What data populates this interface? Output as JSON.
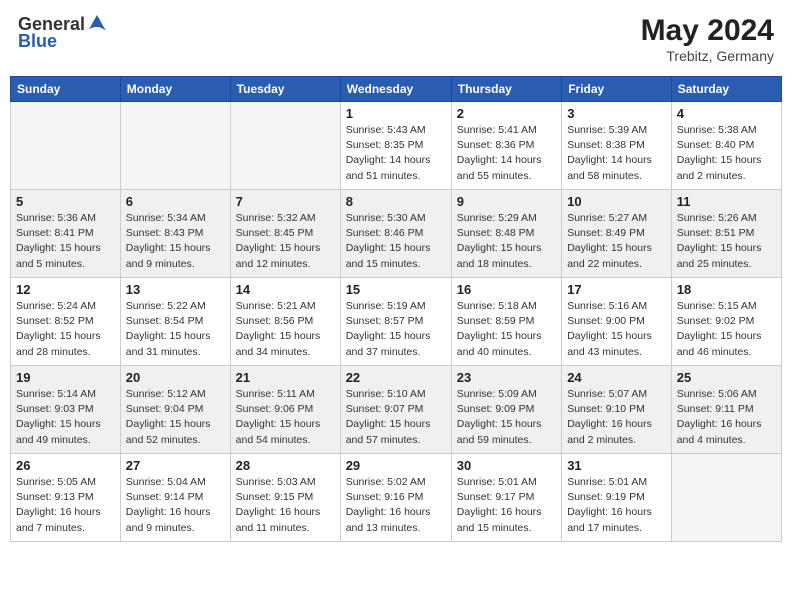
{
  "header": {
    "logo_general": "General",
    "logo_blue": "Blue",
    "month_year": "May 2024",
    "location": "Trebitz, Germany"
  },
  "days_of_week": [
    "Sunday",
    "Monday",
    "Tuesday",
    "Wednesday",
    "Thursday",
    "Friday",
    "Saturday"
  ],
  "weeks": [
    [
      {
        "day": "",
        "info": ""
      },
      {
        "day": "",
        "info": ""
      },
      {
        "day": "",
        "info": ""
      },
      {
        "day": "1",
        "info": "Sunrise: 5:43 AM\nSunset: 8:35 PM\nDaylight: 14 hours\nand 51 minutes."
      },
      {
        "day": "2",
        "info": "Sunrise: 5:41 AM\nSunset: 8:36 PM\nDaylight: 14 hours\nand 55 minutes."
      },
      {
        "day": "3",
        "info": "Sunrise: 5:39 AM\nSunset: 8:38 PM\nDaylight: 14 hours\nand 58 minutes."
      },
      {
        "day": "4",
        "info": "Sunrise: 5:38 AM\nSunset: 8:40 PM\nDaylight: 15 hours\nand 2 minutes."
      }
    ],
    [
      {
        "day": "5",
        "info": "Sunrise: 5:36 AM\nSunset: 8:41 PM\nDaylight: 15 hours\nand 5 minutes."
      },
      {
        "day": "6",
        "info": "Sunrise: 5:34 AM\nSunset: 8:43 PM\nDaylight: 15 hours\nand 9 minutes."
      },
      {
        "day": "7",
        "info": "Sunrise: 5:32 AM\nSunset: 8:45 PM\nDaylight: 15 hours\nand 12 minutes."
      },
      {
        "day": "8",
        "info": "Sunrise: 5:30 AM\nSunset: 8:46 PM\nDaylight: 15 hours\nand 15 minutes."
      },
      {
        "day": "9",
        "info": "Sunrise: 5:29 AM\nSunset: 8:48 PM\nDaylight: 15 hours\nand 18 minutes."
      },
      {
        "day": "10",
        "info": "Sunrise: 5:27 AM\nSunset: 8:49 PM\nDaylight: 15 hours\nand 22 minutes."
      },
      {
        "day": "11",
        "info": "Sunrise: 5:26 AM\nSunset: 8:51 PM\nDaylight: 15 hours\nand 25 minutes."
      }
    ],
    [
      {
        "day": "12",
        "info": "Sunrise: 5:24 AM\nSunset: 8:52 PM\nDaylight: 15 hours\nand 28 minutes."
      },
      {
        "day": "13",
        "info": "Sunrise: 5:22 AM\nSunset: 8:54 PM\nDaylight: 15 hours\nand 31 minutes."
      },
      {
        "day": "14",
        "info": "Sunrise: 5:21 AM\nSunset: 8:56 PM\nDaylight: 15 hours\nand 34 minutes."
      },
      {
        "day": "15",
        "info": "Sunrise: 5:19 AM\nSunset: 8:57 PM\nDaylight: 15 hours\nand 37 minutes."
      },
      {
        "day": "16",
        "info": "Sunrise: 5:18 AM\nSunset: 8:59 PM\nDaylight: 15 hours\nand 40 minutes."
      },
      {
        "day": "17",
        "info": "Sunrise: 5:16 AM\nSunset: 9:00 PM\nDaylight: 15 hours\nand 43 minutes."
      },
      {
        "day": "18",
        "info": "Sunrise: 5:15 AM\nSunset: 9:02 PM\nDaylight: 15 hours\nand 46 minutes."
      }
    ],
    [
      {
        "day": "19",
        "info": "Sunrise: 5:14 AM\nSunset: 9:03 PM\nDaylight: 15 hours\nand 49 minutes."
      },
      {
        "day": "20",
        "info": "Sunrise: 5:12 AM\nSunset: 9:04 PM\nDaylight: 15 hours\nand 52 minutes."
      },
      {
        "day": "21",
        "info": "Sunrise: 5:11 AM\nSunset: 9:06 PM\nDaylight: 15 hours\nand 54 minutes."
      },
      {
        "day": "22",
        "info": "Sunrise: 5:10 AM\nSunset: 9:07 PM\nDaylight: 15 hours\nand 57 minutes."
      },
      {
        "day": "23",
        "info": "Sunrise: 5:09 AM\nSunset: 9:09 PM\nDaylight: 15 hours\nand 59 minutes."
      },
      {
        "day": "24",
        "info": "Sunrise: 5:07 AM\nSunset: 9:10 PM\nDaylight: 16 hours\nand 2 minutes."
      },
      {
        "day": "25",
        "info": "Sunrise: 5:06 AM\nSunset: 9:11 PM\nDaylight: 16 hours\nand 4 minutes."
      }
    ],
    [
      {
        "day": "26",
        "info": "Sunrise: 5:05 AM\nSunset: 9:13 PM\nDaylight: 16 hours\nand 7 minutes."
      },
      {
        "day": "27",
        "info": "Sunrise: 5:04 AM\nSunset: 9:14 PM\nDaylight: 16 hours\nand 9 minutes."
      },
      {
        "day": "28",
        "info": "Sunrise: 5:03 AM\nSunset: 9:15 PM\nDaylight: 16 hours\nand 11 minutes."
      },
      {
        "day": "29",
        "info": "Sunrise: 5:02 AM\nSunset: 9:16 PM\nDaylight: 16 hours\nand 13 minutes."
      },
      {
        "day": "30",
        "info": "Sunrise: 5:01 AM\nSunset: 9:17 PM\nDaylight: 16 hours\nand 15 minutes."
      },
      {
        "day": "31",
        "info": "Sunrise: 5:01 AM\nSunset: 9:19 PM\nDaylight: 16 hours\nand 17 minutes."
      },
      {
        "day": "",
        "info": ""
      }
    ]
  ]
}
